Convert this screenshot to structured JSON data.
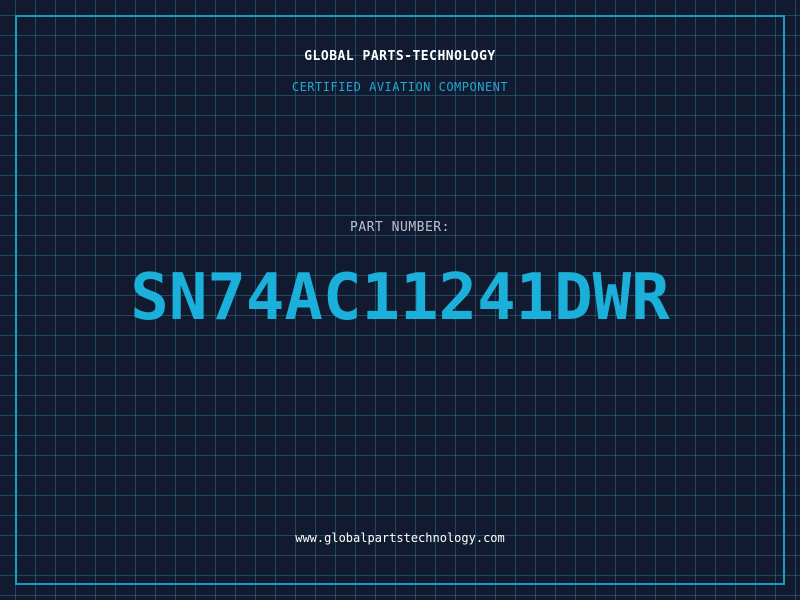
{
  "header": {
    "company": "GLOBAL PARTS-TECHNOLOGY",
    "tagline": "CERTIFIED AVIATION COMPONENT"
  },
  "part": {
    "label": "PART NUMBER:",
    "number": "SN74AC11241DWR"
  },
  "footer": {
    "website": "www.globalpartstechnology.com"
  },
  "colors": {
    "background": "#111a2e",
    "grid": "#286e8c",
    "accent": "#1ab0da",
    "frame": "#1a9bc2"
  }
}
